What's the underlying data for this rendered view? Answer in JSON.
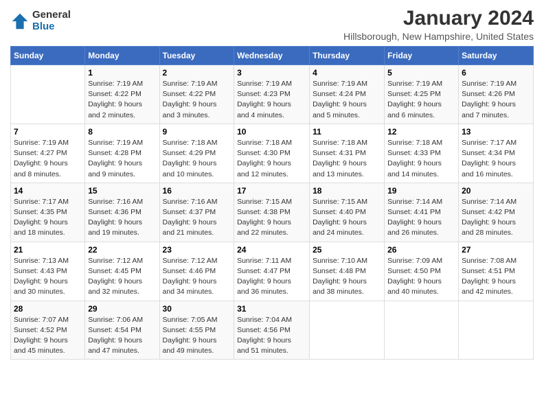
{
  "header": {
    "logo_general": "General",
    "logo_blue": "Blue",
    "title": "January 2024",
    "subtitle": "Hillsborough, New Hampshire, United States"
  },
  "calendar": {
    "days_of_week": [
      "Sunday",
      "Monday",
      "Tuesday",
      "Wednesday",
      "Thursday",
      "Friday",
      "Saturday"
    ],
    "weeks": [
      [
        {
          "day": "",
          "detail": ""
        },
        {
          "day": "1",
          "detail": "Sunrise: 7:19 AM\nSunset: 4:22 PM\nDaylight: 9 hours\nand 2 minutes."
        },
        {
          "day": "2",
          "detail": "Sunrise: 7:19 AM\nSunset: 4:22 PM\nDaylight: 9 hours\nand 3 minutes."
        },
        {
          "day": "3",
          "detail": "Sunrise: 7:19 AM\nSunset: 4:23 PM\nDaylight: 9 hours\nand 4 minutes."
        },
        {
          "day": "4",
          "detail": "Sunrise: 7:19 AM\nSunset: 4:24 PM\nDaylight: 9 hours\nand 5 minutes."
        },
        {
          "day": "5",
          "detail": "Sunrise: 7:19 AM\nSunset: 4:25 PM\nDaylight: 9 hours\nand 6 minutes."
        },
        {
          "day": "6",
          "detail": "Sunrise: 7:19 AM\nSunset: 4:26 PM\nDaylight: 9 hours\nand 7 minutes."
        }
      ],
      [
        {
          "day": "7",
          "detail": "Sunrise: 7:19 AM\nSunset: 4:27 PM\nDaylight: 9 hours\nand 8 minutes."
        },
        {
          "day": "8",
          "detail": "Sunrise: 7:19 AM\nSunset: 4:28 PM\nDaylight: 9 hours\nand 9 minutes."
        },
        {
          "day": "9",
          "detail": "Sunrise: 7:18 AM\nSunset: 4:29 PM\nDaylight: 9 hours\nand 10 minutes."
        },
        {
          "day": "10",
          "detail": "Sunrise: 7:18 AM\nSunset: 4:30 PM\nDaylight: 9 hours\nand 12 minutes."
        },
        {
          "day": "11",
          "detail": "Sunrise: 7:18 AM\nSunset: 4:31 PM\nDaylight: 9 hours\nand 13 minutes."
        },
        {
          "day": "12",
          "detail": "Sunrise: 7:18 AM\nSunset: 4:33 PM\nDaylight: 9 hours\nand 14 minutes."
        },
        {
          "day": "13",
          "detail": "Sunrise: 7:17 AM\nSunset: 4:34 PM\nDaylight: 9 hours\nand 16 minutes."
        }
      ],
      [
        {
          "day": "14",
          "detail": "Sunrise: 7:17 AM\nSunset: 4:35 PM\nDaylight: 9 hours\nand 18 minutes."
        },
        {
          "day": "15",
          "detail": "Sunrise: 7:16 AM\nSunset: 4:36 PM\nDaylight: 9 hours\nand 19 minutes."
        },
        {
          "day": "16",
          "detail": "Sunrise: 7:16 AM\nSunset: 4:37 PM\nDaylight: 9 hours\nand 21 minutes."
        },
        {
          "day": "17",
          "detail": "Sunrise: 7:15 AM\nSunset: 4:38 PM\nDaylight: 9 hours\nand 22 minutes."
        },
        {
          "day": "18",
          "detail": "Sunrise: 7:15 AM\nSunset: 4:40 PM\nDaylight: 9 hours\nand 24 minutes."
        },
        {
          "day": "19",
          "detail": "Sunrise: 7:14 AM\nSunset: 4:41 PM\nDaylight: 9 hours\nand 26 minutes."
        },
        {
          "day": "20",
          "detail": "Sunrise: 7:14 AM\nSunset: 4:42 PM\nDaylight: 9 hours\nand 28 minutes."
        }
      ],
      [
        {
          "day": "21",
          "detail": "Sunrise: 7:13 AM\nSunset: 4:43 PM\nDaylight: 9 hours\nand 30 minutes."
        },
        {
          "day": "22",
          "detail": "Sunrise: 7:12 AM\nSunset: 4:45 PM\nDaylight: 9 hours\nand 32 minutes."
        },
        {
          "day": "23",
          "detail": "Sunrise: 7:12 AM\nSunset: 4:46 PM\nDaylight: 9 hours\nand 34 minutes."
        },
        {
          "day": "24",
          "detail": "Sunrise: 7:11 AM\nSunset: 4:47 PM\nDaylight: 9 hours\nand 36 minutes."
        },
        {
          "day": "25",
          "detail": "Sunrise: 7:10 AM\nSunset: 4:48 PM\nDaylight: 9 hours\nand 38 minutes."
        },
        {
          "day": "26",
          "detail": "Sunrise: 7:09 AM\nSunset: 4:50 PM\nDaylight: 9 hours\nand 40 minutes."
        },
        {
          "day": "27",
          "detail": "Sunrise: 7:08 AM\nSunset: 4:51 PM\nDaylight: 9 hours\nand 42 minutes."
        }
      ],
      [
        {
          "day": "28",
          "detail": "Sunrise: 7:07 AM\nSunset: 4:52 PM\nDaylight: 9 hours\nand 45 minutes."
        },
        {
          "day": "29",
          "detail": "Sunrise: 7:06 AM\nSunset: 4:54 PM\nDaylight: 9 hours\nand 47 minutes."
        },
        {
          "day": "30",
          "detail": "Sunrise: 7:05 AM\nSunset: 4:55 PM\nDaylight: 9 hours\nand 49 minutes."
        },
        {
          "day": "31",
          "detail": "Sunrise: 7:04 AM\nSunset: 4:56 PM\nDaylight: 9 hours\nand 51 minutes."
        },
        {
          "day": "",
          "detail": ""
        },
        {
          "day": "",
          "detail": ""
        },
        {
          "day": "",
          "detail": ""
        }
      ]
    ]
  }
}
